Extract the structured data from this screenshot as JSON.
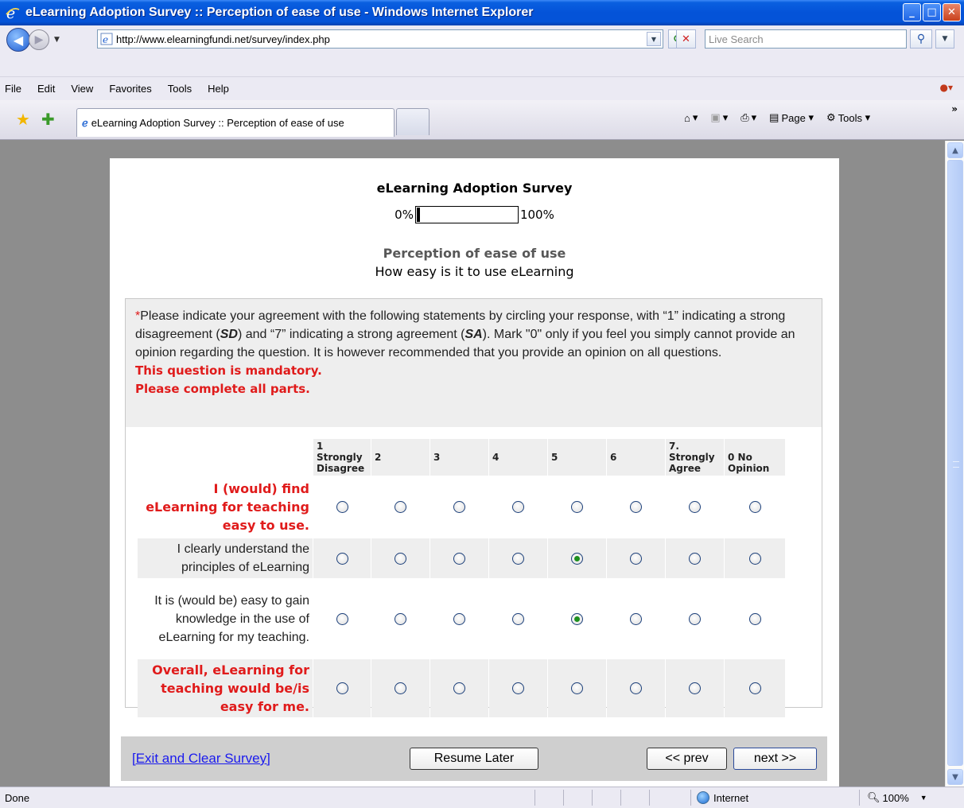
{
  "window": {
    "title": "eLearning Adoption Survey :: Perception of ease of use - Windows Internet Explorer",
    "min_glyph": "_",
    "max_glyph": "□",
    "close_glyph": "✕"
  },
  "address": {
    "url": "http://www.elearningfundi.net/survey/index.php",
    "search_placeholder": "Live Search"
  },
  "menu": [
    "File",
    "Edit",
    "View",
    "Favorites",
    "Tools",
    "Help"
  ],
  "tab": {
    "title": "eLearning Adoption Survey :: Perception of ease of use"
  },
  "commands": {
    "page_label": "Page",
    "tools_label": "Tools"
  },
  "survey": {
    "title": "eLearning Adoption Survey",
    "progress_start": "0%",
    "progress_end": "100%",
    "progress_fraction": 0.03,
    "group_title": "Perception of ease of use",
    "group_description": "How easy is it to use eLearning",
    "question": {
      "asterisk": "*",
      "text": "Please indicate your agreement with the following statements by circling your response, with “1” indicating a strong disagreement (SD) and “7” indicating a strong agreement (SA). Mark \"0\" only if you feel you simply cannot provide an opinion regarding the question. It is however recommended that you provide an opinion on all questions.",
      "text_parts": {
        "p1": "Please indicate your agreement with the following statements by circling your response, with “1” indicating a strong disagreement (",
        "sd": "SD",
        "p2": ") and “7” indicating a strong agreement (",
        "sa": "SA",
        "p3": "). Mark \"0\" only if you feel you simply cannot provide an opinion regarding the question. It is however recommended that you provide an opinion on all questions."
      },
      "mandatory": "This question is mandatory.",
      "complete_all": "Please complete all parts."
    },
    "columns": [
      [
        "1 Strongly",
        "Disagree"
      ],
      [
        "2",
        ""
      ],
      [
        "3",
        ""
      ],
      [
        "4",
        ""
      ],
      [
        "5",
        ""
      ],
      [
        "6",
        ""
      ],
      [
        "7. Strongly",
        "Agree"
      ],
      [
        "0 No",
        "Opinion"
      ]
    ],
    "rows": [
      {
        "label": "I (would) find eLearning for teaching easy to use.",
        "required": true,
        "selected": null
      },
      {
        "label": "I clearly understand the principles of eLearning",
        "required": false,
        "selected": 4
      },
      {
        "label": "It is (would be) easy to gain knowledge in the use of eLearning for my teaching.",
        "required": false,
        "selected": 4
      },
      {
        "label": "Overall, eLearning for teaching would be/is easy for me.",
        "required": true,
        "selected": null
      }
    ],
    "exit_link": "[Exit and Clear Survey]",
    "resume_label": "Resume Later",
    "prev_label": "<< prev",
    "next_label": "next >>"
  },
  "status": {
    "text": "Done",
    "zone": "Internet",
    "zoom": "100%"
  },
  "colors": {
    "required_text": "#e01b1b",
    "link": "#1a1aee",
    "title_bar": "#0453d8"
  }
}
